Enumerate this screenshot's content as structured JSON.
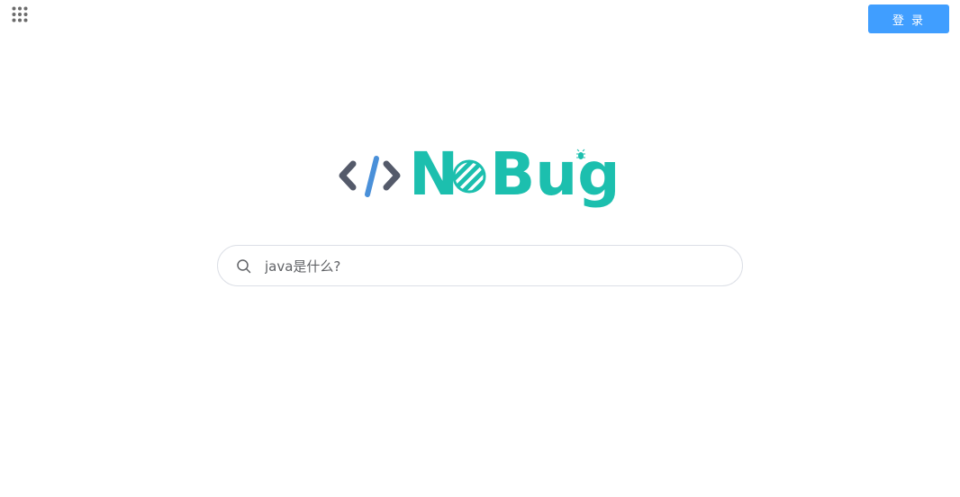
{
  "header": {
    "apps_icon": "grid-dots-icon",
    "login_label": "登 录"
  },
  "logo": {
    "text_no": "No",
    "text_bug": "Bug",
    "colors": {
      "brackets": "#545a6a",
      "slash": "#4a90d9",
      "brand": "#1cbfae"
    }
  },
  "search": {
    "value": "java是什么?",
    "icon": "search-icon"
  }
}
